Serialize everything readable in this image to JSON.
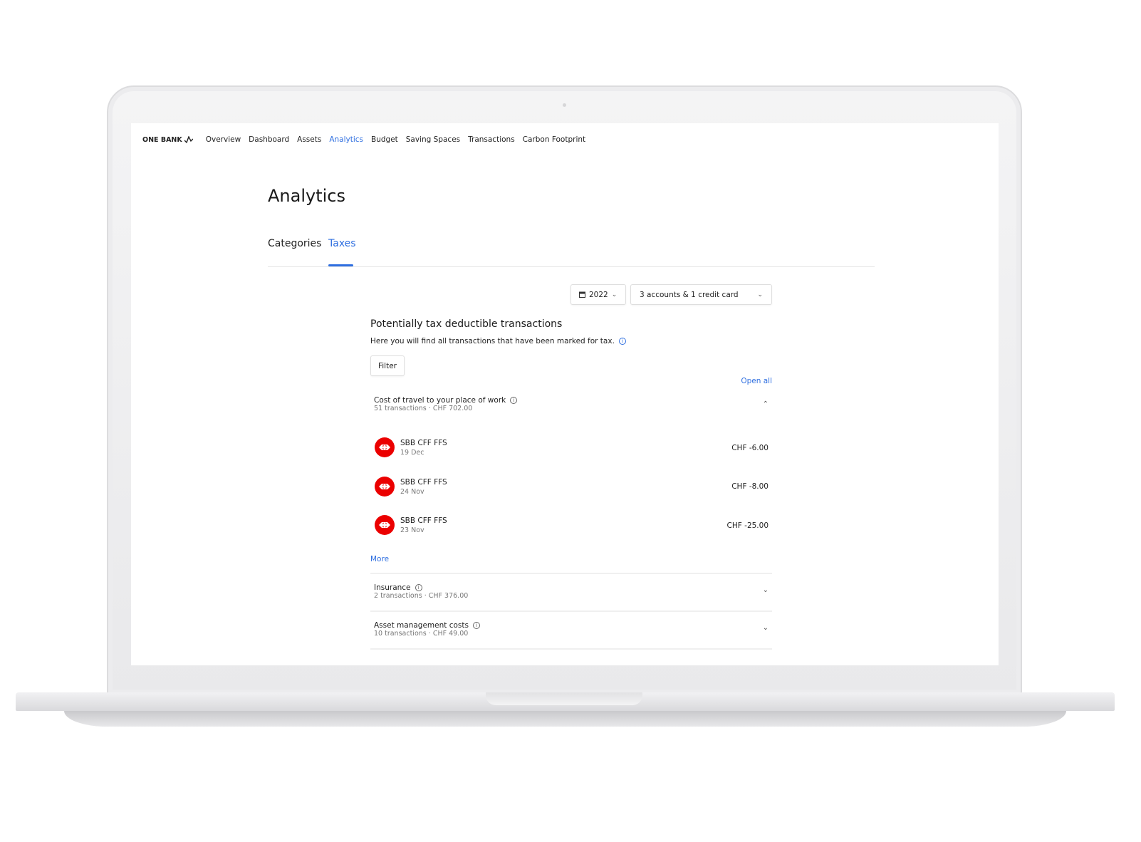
{
  "nav": {
    "logo": "ONE BANK",
    "items": [
      {
        "label": "Overview"
      },
      {
        "label": "Dashboard"
      },
      {
        "label": "Assets"
      },
      {
        "label": "Analytics",
        "active": true
      },
      {
        "label": "Budget"
      },
      {
        "label": "Saving Spaces"
      },
      {
        "label": "Transactions"
      },
      {
        "label": "Carbon Footprint"
      }
    ]
  },
  "page": {
    "title": "Analytics",
    "tabs": [
      {
        "label": "Categories"
      },
      {
        "label": "Taxes",
        "active": true
      }
    ]
  },
  "filters": {
    "year": "2022",
    "accounts": "3 accounts & 1 credit card"
  },
  "section": {
    "heading": "Potentially tax deductible transactions",
    "description": "Here you will find all transactions that have been marked for tax.",
    "filter_label": "Filter",
    "open_all": "Open all",
    "more": "More"
  },
  "groups": [
    {
      "title": "Cost of travel to your place of work",
      "count": "51 transactions",
      "total": "CHF 702.00",
      "expanded": true
    },
    {
      "title": "Insurance",
      "count": "2 transactions",
      "total": "CHF 376.00",
      "expanded": false
    },
    {
      "title": "Asset management costs",
      "count": "10 transactions",
      "total": "CHF 49.00",
      "expanded": false
    }
  ],
  "transactions": [
    {
      "merchant": "SBB CFF FFS",
      "date": "19 Dec",
      "amount": "CHF -6.00"
    },
    {
      "merchant": "SBB CFF FFS",
      "date": "24 Nov",
      "amount": "CHF -8.00"
    },
    {
      "merchant": "SBB CFF FFS",
      "date": "23 Nov",
      "amount": "CHF -25.00"
    }
  ],
  "colors": {
    "accent": "#2f6fe0",
    "sbb_red": "#eb0000"
  },
  "sep": "·"
}
